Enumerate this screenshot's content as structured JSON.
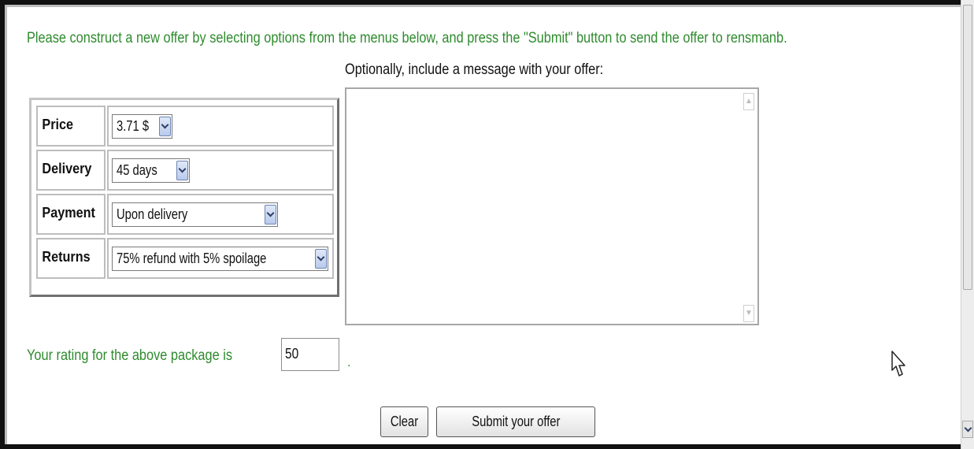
{
  "instruction": "Please construct a new offer by selecting options from the menus below, and press the \"Submit\" button to send the offer to rensmanb.",
  "message": {
    "label": "Optionally, include a message with your offer:",
    "value": ""
  },
  "offer": {
    "rows": [
      {
        "label": "Price",
        "value": "3.71 $"
      },
      {
        "label": "Delivery",
        "value": "45 days"
      },
      {
        "label": "Payment",
        "value": "Upon delivery"
      },
      {
        "label": "Returns",
        "value": "75% refund with 5% spoilage"
      }
    ]
  },
  "rating": {
    "label": "Your rating for the above package is",
    "value": "50",
    "suffix": "."
  },
  "buttons": {
    "clear": "Clear",
    "submit": "Submit your offer"
  },
  "icons": {
    "dropdown": "chevron-down-icon",
    "cursor": "mouse-pointer-icon",
    "scroll_up": "chevron-up-icon",
    "scroll_down": "chevron-down-icon"
  },
  "colors": {
    "prompt_text": "#2e8b2e",
    "label_text": "#111111"
  }
}
